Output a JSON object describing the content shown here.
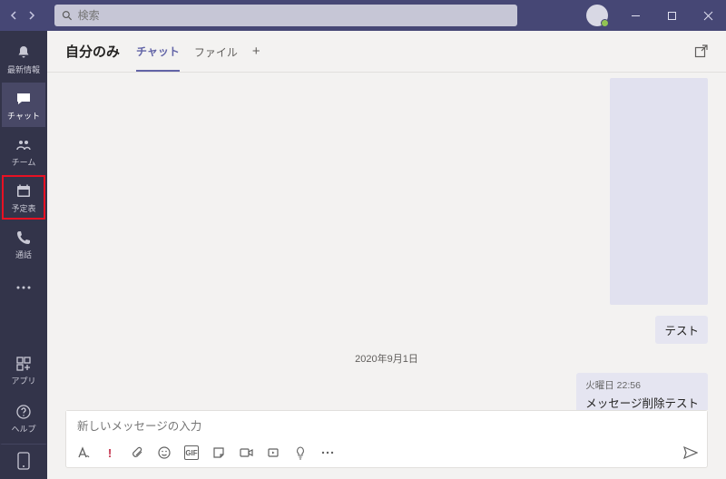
{
  "search": {
    "placeholder": "検索"
  },
  "rail": {
    "items": [
      {
        "label": "最新情報"
      },
      {
        "label": "チャット"
      },
      {
        "label": "チーム"
      },
      {
        "label": "予定表"
      },
      {
        "label": "通話"
      }
    ],
    "apps_label": "アプリ",
    "help_label": "ヘルプ"
  },
  "chat": {
    "title": "自分のみ",
    "tabs": {
      "chat": "チャット",
      "file": "ファイル"
    },
    "date_separator": "2020年9月1日",
    "messages": [
      {
        "text": "テスト"
      },
      {
        "meta": "火曜日 22:56",
        "text": "メッセージ削除テスト"
      }
    ]
  },
  "compose": {
    "placeholder": "新しいメッセージの入力",
    "gif_label": "GIF"
  }
}
